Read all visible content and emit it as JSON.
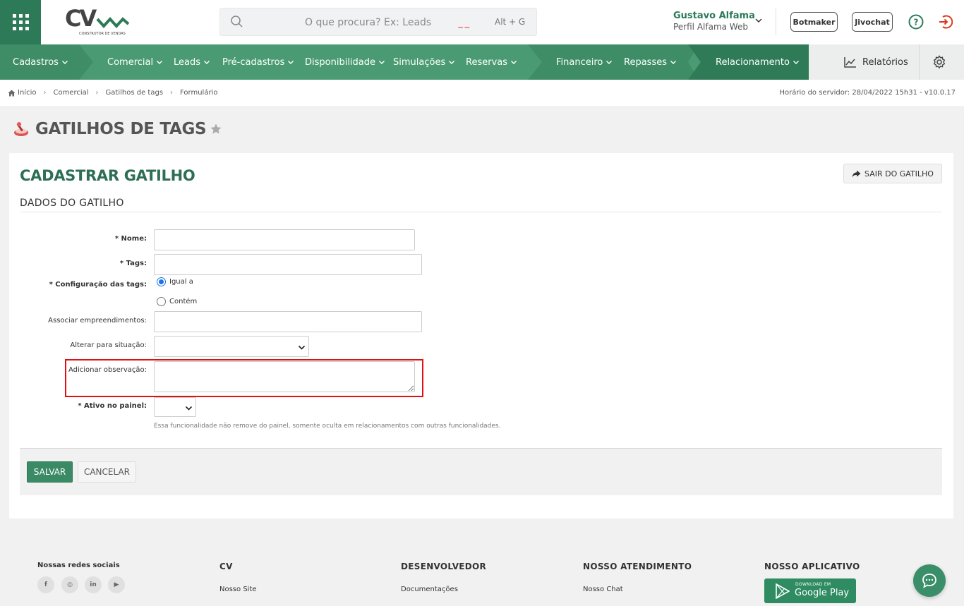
{
  "header": {
    "search_placeholder": "O que procura? Ex: Leads",
    "search_squiggle": "~~",
    "search_shortcut": "Alt + G",
    "user_name": "Gustavo Alfama",
    "user_profile": "Perfil Alfama Web",
    "botmaker_label": "Botmaker",
    "jivochat_label": "Jivochat",
    "logo_text": "CV",
    "logo_subtitle": "CONSTRUTOR DE VENDAS"
  },
  "nav": {
    "items": [
      {
        "label": "Cadastros"
      },
      {
        "label": "Comercial"
      },
      {
        "label": "Leads"
      },
      {
        "label": "Pré-cadastros"
      },
      {
        "label": "Disponibilidade"
      },
      {
        "label": "Simulações"
      },
      {
        "label": "Reservas"
      },
      {
        "label": "Financeiro"
      },
      {
        "label": "Repasses"
      },
      {
        "label": "Relacionamento"
      }
    ],
    "reports_label": "Relatórios"
  },
  "breadcrumb": {
    "items": [
      "Início",
      "Comercial",
      "Gatilhos de tags",
      "Formulário"
    ],
    "server_time": "Horário do servidor: 28/04/2022 15h31 - v10.0.17"
  },
  "page": {
    "title": "GATILHOS DE TAGS"
  },
  "form": {
    "title": "CADASTRAR GATILHO",
    "exit_label": "SAIR DO GATILHO",
    "section_title": "DADOS DO GATILHO",
    "name_label": "* Nome:",
    "tags_label": "* Tags:",
    "config_label": "* Configuração das tags:",
    "config_option_equal": "Igual a",
    "config_option_contains": "Contém",
    "associate_label": "Associar empreendimentos:",
    "situation_label": "Alterar para situação:",
    "observation_label": "Adicionar observação:",
    "active_label": "* Ativo no painel:",
    "active_hint": "Essa funcionalidade não remove do painel, somente oculta em relacionamentos com outras funcionalidades.",
    "save_label": "SALVAR",
    "cancel_label": "CANCELAR"
  },
  "footer": {
    "social_title": "Nossas redes sociais",
    "social_icons": [
      "f",
      "◎",
      "in",
      "▶"
    ],
    "cv_title": "CV",
    "cv_link": "Nosso Site",
    "dev_title": "DESENVOLVEDOR",
    "dev_link": "Documentações",
    "support_title": "NOSSO ATENDIMENTO",
    "support_link": "Nosso Chat",
    "app_title": "NOSSO APLICATIVO",
    "gplay_small": "DOWNLOAD EM",
    "gplay_big": "Google Play"
  },
  "colors": {
    "brand_green": "#2d7a58",
    "nav_green": "#4a9b73",
    "highlight_red": "#e01010"
  }
}
